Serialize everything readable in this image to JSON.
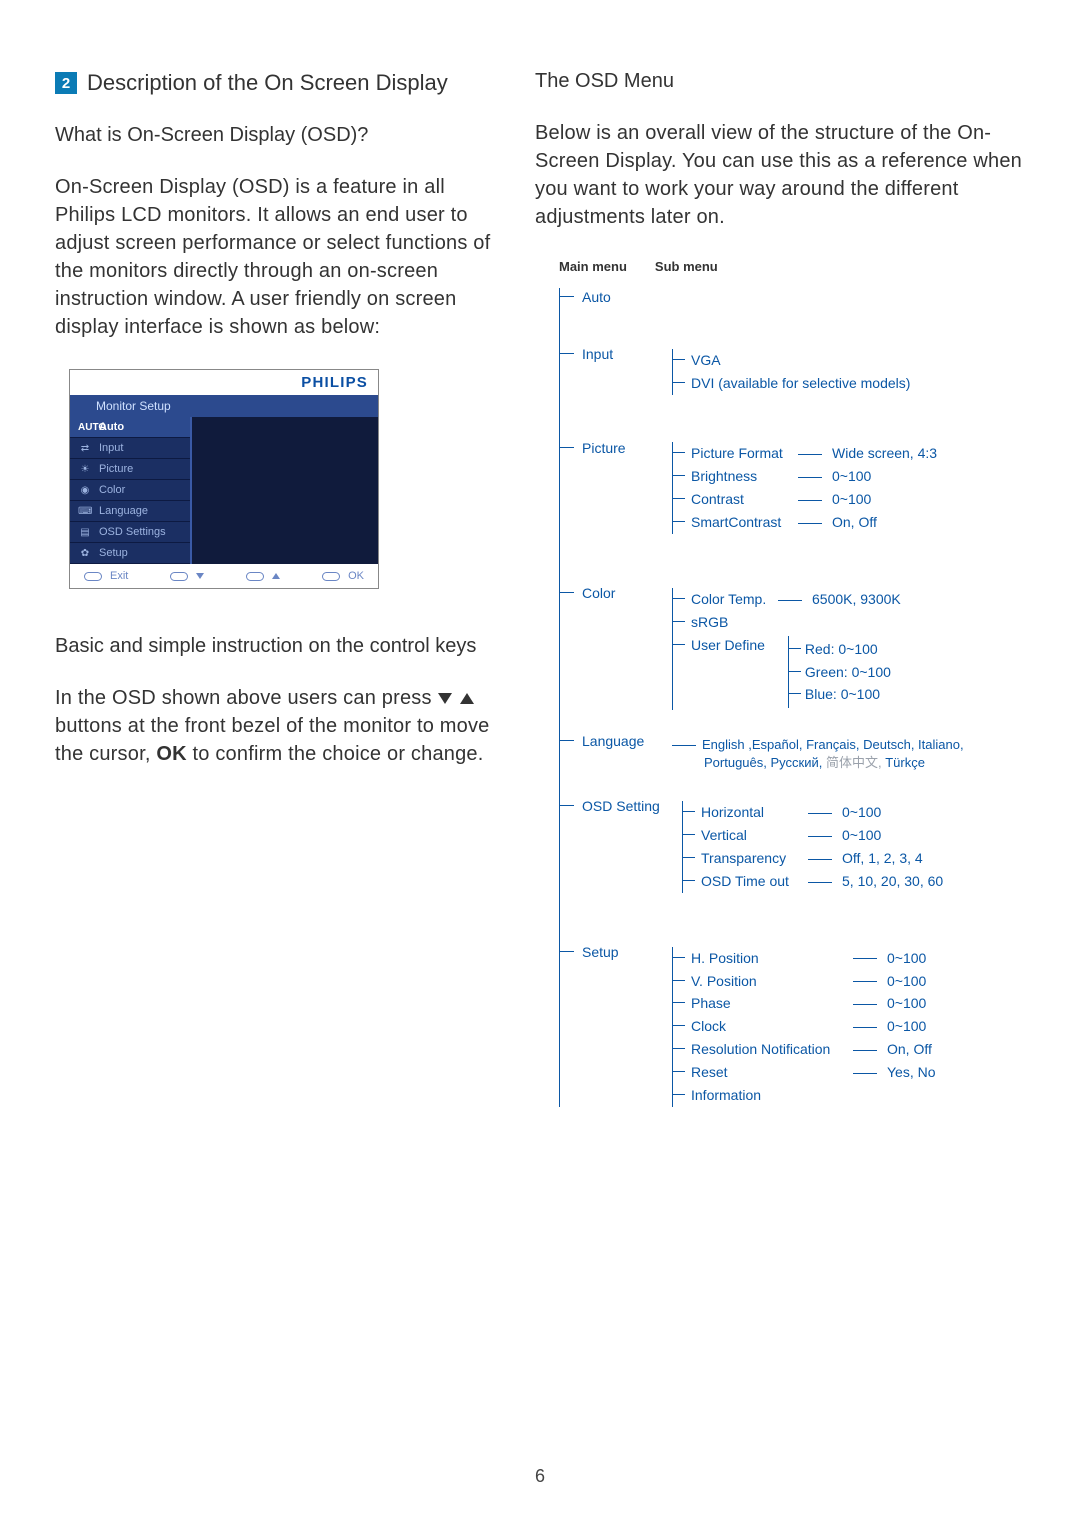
{
  "section": {
    "number": "2",
    "title": "Description of the On Screen Display"
  },
  "left": {
    "q_heading": "What is On-Screen Display (OSD)?",
    "para1": "On-Screen Display (OSD) is a feature in all Philips LCD monitors. It allows an end user to adjust screen performance or select functions of the monitors directly through an on-screen instruction window. A user friendly on screen display interface is shown as below:",
    "basic_heading": "Basic and simple instruction on the control keys",
    "para2_a": "In the OSD shown above users can press ",
    "para2_b": " buttons at the front bezel of the monitor to move the cursor, ",
    "ok": "OK",
    "para2_c": " to confirm the choice or change."
  },
  "osd": {
    "brand": "PHILIPS",
    "title": "Monitor Setup",
    "menu": [
      "Auto",
      "Input",
      "Picture",
      "Color",
      "Language",
      "OSD Settings",
      "Setup"
    ],
    "menu_icons": [
      "AUTO",
      "⇄",
      "☀",
      "◉",
      "⌨",
      "▤",
      "✿"
    ],
    "foot_exit": "Exit",
    "foot_ok": "OK"
  },
  "right": {
    "heading": "The OSD Menu",
    "para": "Below is an overall view of the structure of the On-Screen Display. You can use this as a reference when you want to work your way around the different adjustments later on.",
    "header_main": "Main menu",
    "header_sub": "Sub menu"
  },
  "tree": {
    "auto": "Auto",
    "input": "Input",
    "input_sub": [
      "VGA",
      "DVI (available for selective models)"
    ],
    "picture": "Picture",
    "picture_sub": [
      {
        "label": "Picture Format",
        "range": "Wide screen, 4:3"
      },
      {
        "label": "Brightness",
        "range": "0~100"
      },
      {
        "label": "Contrast",
        "range": "0~100"
      },
      {
        "label": "SmartContrast",
        "range": "On, Off"
      }
    ],
    "color": "Color",
    "color_sub": {
      "temp": {
        "label": "Color Temp.",
        "range": "6500K, 9300K"
      },
      "srgb": "sRGB",
      "user": {
        "label": "User Define",
        "items": [
          "Red: 0~100",
          "Green: 0~100",
          "Blue: 0~100"
        ]
      }
    },
    "language": "Language",
    "language_vals_a": "English ,Español, Français, Deutsch, Italiano,",
    "language_vals_b": "Português, Русский,",
    "language_vals_c": " 简体中文, ",
    "language_vals_d": "Türkçe",
    "osd_setting": "OSD Setting",
    "osd_sub": [
      {
        "label": "Horizontal",
        "range": "0~100"
      },
      {
        "label": "Vertical",
        "range": "0~100"
      },
      {
        "label": "Transparency",
        "range": "Off, 1, 2, 3, 4"
      },
      {
        "label": "OSD Time out",
        "range": "5, 10, 20, 30, 60"
      }
    ],
    "setup": "Setup",
    "setup_sub": [
      {
        "label": "H. Position",
        "range": "0~100"
      },
      {
        "label": "V. Position",
        "range": "0~100"
      },
      {
        "label": "Phase",
        "range": "0~100"
      },
      {
        "label": "Clock",
        "range": "0~100"
      },
      {
        "label": "Resolution Notification",
        "range": "On, Off"
      },
      {
        "label": "Reset",
        "range": "Yes, No"
      },
      {
        "label": "Information",
        "range": ""
      }
    ]
  },
  "page_number": "6"
}
